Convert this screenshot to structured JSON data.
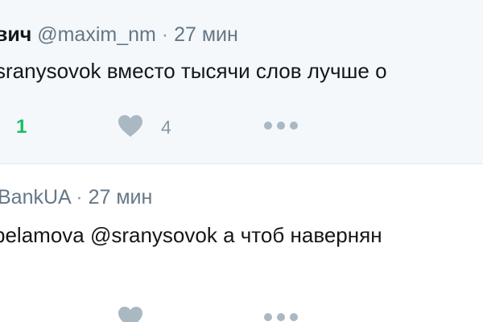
{
  "tweets": [
    {
      "author_name": "вич",
      "handle": "@maxim_nm",
      "separator": "·",
      "time": "27 мин",
      "text": "sranysovok вместо тысячи слов лучше о",
      "reply_count": "1",
      "like_count": "4",
      "icons": {
        "like": "heart-icon",
        "more": "more-dots-icon"
      },
      "colors": {
        "reply": "#17bf63",
        "icon": "#aab8c2",
        "bg": "#f5f8fa"
      }
    },
    {
      "handle": "BankUA",
      "separator": "·",
      "time": "27 мин",
      "text": "belamova @sranysovok а чтоб навернян",
      "icons": {
        "like": "heart-icon",
        "more": "more-dots-icon"
      }
    }
  ]
}
